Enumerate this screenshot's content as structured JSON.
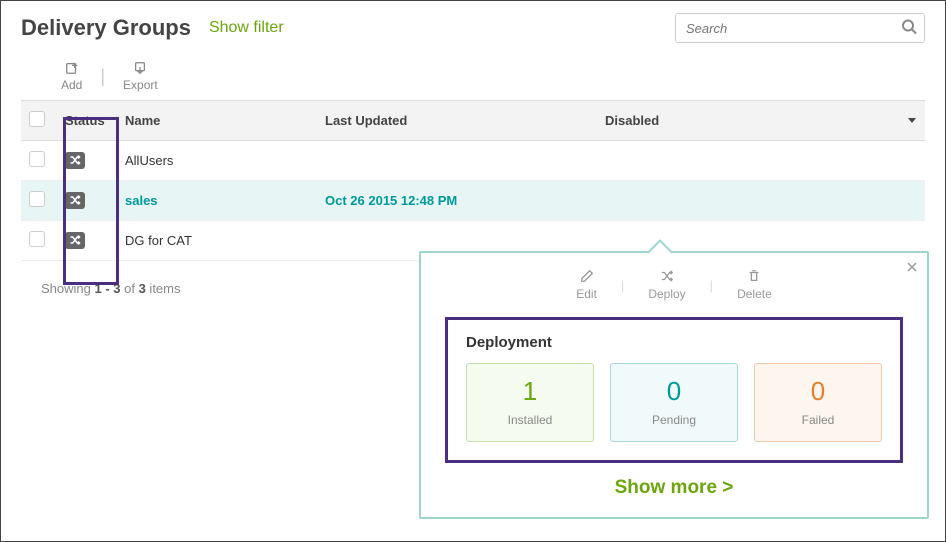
{
  "header": {
    "title": "Delivery Groups",
    "show_filter": "Show filter",
    "search_placeholder": "Search"
  },
  "toolbar": {
    "add": "Add",
    "export": "Export"
  },
  "columns": {
    "status": "Status",
    "name": "Name",
    "last_updated": "Last Updated",
    "disabled": "Disabled"
  },
  "rows": [
    {
      "name": "AllUsers",
      "last_updated": "",
      "selected": false
    },
    {
      "name": "sales",
      "last_updated": "Oct 26 2015 12:48 PM",
      "selected": true
    },
    {
      "name": "DG for CAT",
      "last_updated": "",
      "selected": false
    }
  ],
  "results": {
    "prefix": "Showing ",
    "range": "1 - 3",
    "mid": " of ",
    "total": "3",
    "suffix": " items"
  },
  "detail": {
    "edit": "Edit",
    "deploy": "Deploy",
    "delete": "Delete",
    "deployment_title": "Deployment",
    "installed_num": "1",
    "installed_label": "Installed",
    "pending_num": "0",
    "pending_label": "Pending",
    "failed_num": "0",
    "failed_label": "Failed",
    "show_more": "Show more >"
  }
}
